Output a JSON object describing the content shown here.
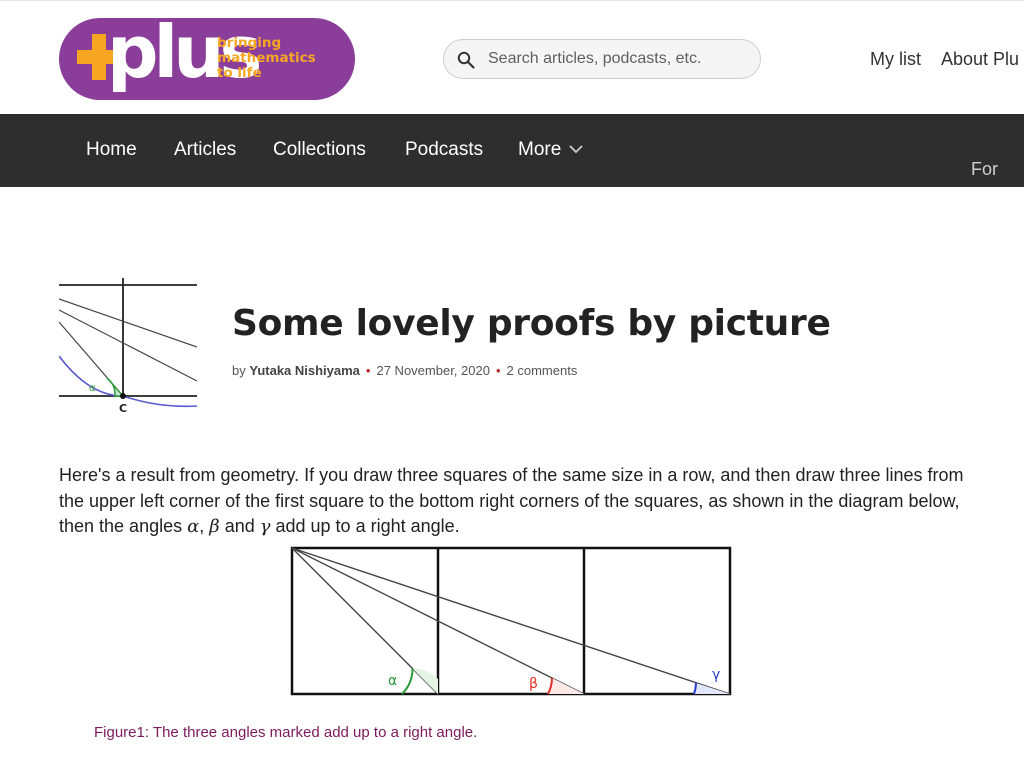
{
  "header": {
    "logo": {
      "word": "plus",
      "tagline": [
        "bringing",
        "mathematics",
        "to life"
      ],
      "bg_color": "#8a3e9a",
      "accent_color": "#f6a623"
    },
    "search": {
      "placeholder": "Search articles, podcasts, etc."
    },
    "links": {
      "my_list": "My list",
      "about": "About Plu"
    }
  },
  "nav": {
    "items": [
      "Home",
      "Articles",
      "Collections",
      "Podcasts",
      "More"
    ],
    "more_icon": "chevron-down-icon",
    "overflow_text": "For"
  },
  "article": {
    "title": "Some lovely proofs by picture",
    "byline": {
      "by": "by",
      "author": "Yutaka Nishiyama",
      "date": "27 November, 2020",
      "comments": "2 comments"
    },
    "intro": {
      "part1": "Here's a result from geometry. If you draw three squares of the same size in a row, and then draw three lines from the upper left corner of the first square to the bottom right corners of the squares, as shown in the diagram below, then the angles ",
      "alpha": "α",
      "comma": ", ",
      "beta": "β",
      "and": " and ",
      "gamma": "γ",
      "part2": " add up to a right angle."
    },
    "thumbnail": {
      "point_label": "C",
      "angle_label": "α"
    },
    "figure": {
      "labels": {
        "alpha": "α",
        "beta": "β",
        "gamma": "γ"
      },
      "colors": {
        "alpha": "#2a9a3a",
        "beta": "#e0302a",
        "gamma": "#2a3fd0"
      },
      "caption": "Figure1: The three angles marked add up to a right angle."
    }
  }
}
